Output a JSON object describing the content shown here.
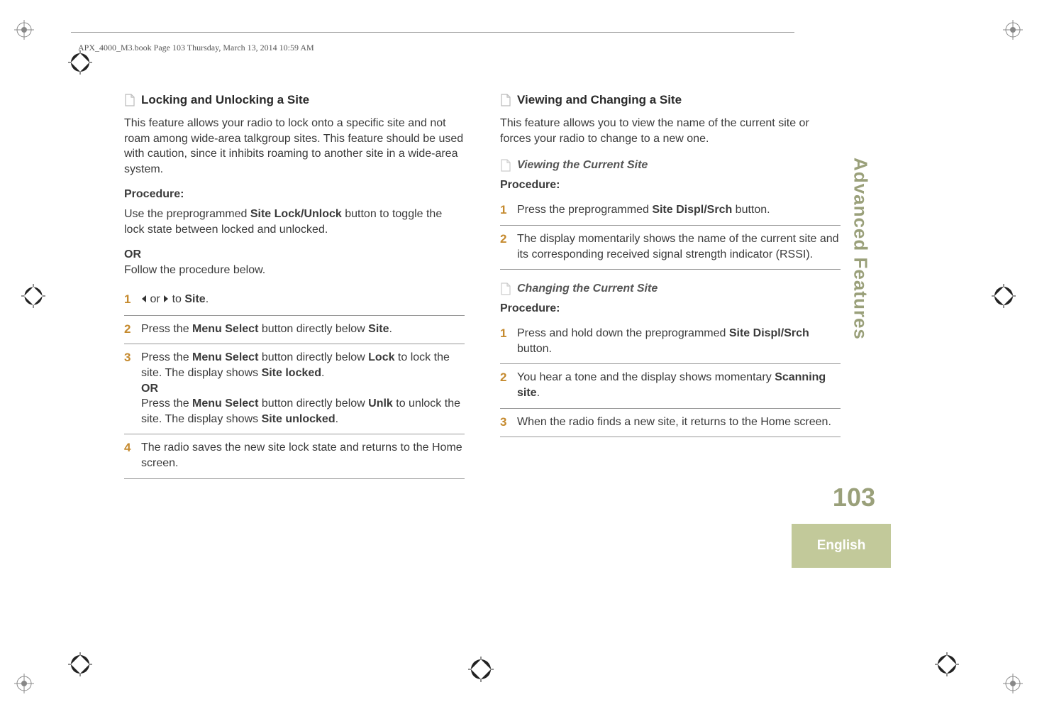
{
  "header": {
    "running": "APX_4000_M3.book  Page 103  Thursday, March 13, 2014  10:59 AM"
  },
  "left": {
    "h1": "Locking and Unlocking a Site",
    "intro": "This feature allows your radio to lock onto a specific site and not roam among wide-area talkgroup sites. This feature should be used with caution, since it inhibits roaming to another site in a wide-area system.",
    "proc": "Procedure:",
    "use_pre": "Use the preprogrammed ",
    "use_btn": "Site Lock/Unlock",
    "use_post": " button to toggle the lock state between locked and unlocked.",
    "or": "OR",
    "follow": "Follow the procedure below.",
    "s1_mid": " or ",
    "s1_to": " to ",
    "s1_site": "Site",
    "s1_end": ".",
    "s2_pre": "Press the ",
    "s2_btn": "Menu Select",
    "s2_mid": " button directly below ",
    "s2_site": "Site",
    "s2_end": ".",
    "s3_pre": "Press the ",
    "s3_btn": "Menu Select",
    "s3_mid": " button directly below ",
    "s3_lock": "Lock",
    "s3_post": " to lock the site. The display shows ",
    "s3_locked": "Site locked",
    "s3_end": ".",
    "s3_or": "OR",
    "s3b_pre": "Press the ",
    "s3b_btn": "Menu Select",
    "s3b_mid": " button directly below ",
    "s3b_unlk": "Unlk",
    "s3b_post": " to unlock the site. The display shows ",
    "s3b_unlocked": "Site unlocked",
    "s3b_end": ".",
    "s4": "The radio saves the new site lock state and returns to the Home screen."
  },
  "right": {
    "h1": "Viewing and Changing a Site",
    "intro": "This feature allows you to view the name of the current site or forces your radio to change to a new one.",
    "h2a": "Viewing the Current Site",
    "proc": "Procedure:",
    "a1_pre": "Press the preprogrammed ",
    "a1_btn": "Site Displ/Srch",
    "a1_post": " button.",
    "a2": "The display momentarily shows the name of the current site and its corresponding received signal strength indicator (RSSI).",
    "h2b": "Changing the Current Site",
    "b1_pre": "Press and hold down the preprogrammed ",
    "b1_btn": "Site Displ/Srch",
    "b1_post": " button.",
    "b2_pre": "You hear a tone and the display shows momentary ",
    "b2_scan": "Scanning site",
    "b2_end": ".",
    "b3": "When the radio finds a new site, it returns to the Home screen."
  },
  "side": {
    "tab": "Advanced Features",
    "page": "103",
    "lang": "English"
  }
}
